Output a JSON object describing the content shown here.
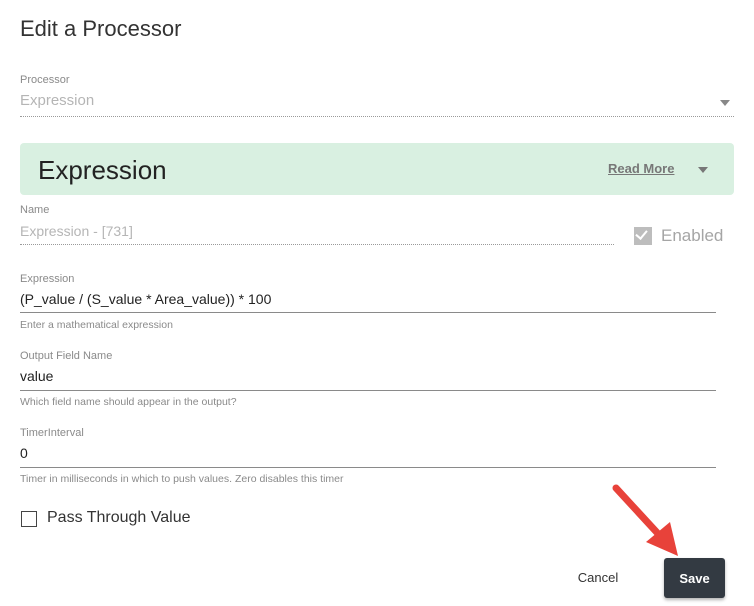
{
  "dialog": {
    "title": "Edit a Processor"
  },
  "processor": {
    "label": "Processor",
    "value": "Expression"
  },
  "banner": {
    "title": "Expression",
    "read_more": "Read More"
  },
  "name_field": {
    "label": "Name",
    "value": "Expression  - [731]"
  },
  "enabled": {
    "label": "Enabled",
    "checked": true
  },
  "expression_field": {
    "label": "Expression",
    "value": "(P_value / (S_value * Area_value)) * 100",
    "helper": "Enter a mathematical expression"
  },
  "output_field": {
    "label": "Output Field Name",
    "value": "value",
    "helper": "Which field name should appear in the output?"
  },
  "timer_field": {
    "label": "TimerInterval",
    "value": "0",
    "helper": "Timer in milliseconds in which to push values. Zero disables this timer"
  },
  "pass_through": {
    "label": "Pass Through Value",
    "checked": false
  },
  "actions": {
    "cancel": "Cancel",
    "save": "Save"
  },
  "colors": {
    "banner_bg": "#d9f0e1",
    "save_bg": "#333a42",
    "arrow": "#e8423a"
  },
  "icons": {
    "dropdown": "chevron-down-icon",
    "annotation": "red-arrow-icon"
  }
}
